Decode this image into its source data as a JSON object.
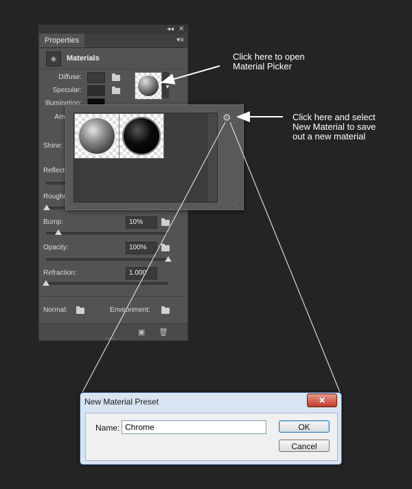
{
  "panel": {
    "tab_label": "Properties",
    "collapse_icon": "◂◂",
    "close_icon": "✕",
    "menu_icon": "▾≡",
    "section_title": "Materials",
    "rows": {
      "diffuse": "Diffuse:",
      "specular": "Specular:",
      "illumination": "Illumination:",
      "ambient": "Ambient:",
      "shine": "Shine:",
      "reflection": "Reflection:",
      "roughness": "Roughness:"
    },
    "bump": {
      "label": "Bump:",
      "value": "10%",
      "level": 0.1
    },
    "opacity": {
      "label": "Opacity:",
      "value": "100%",
      "level": 1.0
    },
    "refraction": {
      "label": "Refraction:",
      "value": "1.000",
      "level": 0.0
    },
    "normal_label": "Normal:",
    "environment_label": "Environment:"
  },
  "picker": {
    "materials": [
      "chrome-sphere",
      "black-glossy-sphere"
    ],
    "gear_icon": "⚙"
  },
  "annotations": {
    "picker_note_line1": "Click here to open",
    "picker_note_line2": "Material Picker",
    "gear_note_line1": "Click here and select",
    "gear_note_line2": "New Material to save",
    "gear_note_line3": "out a new material"
  },
  "dialog": {
    "title": "New Material Preset",
    "close_icon": "✕",
    "name_label": "Name:",
    "name_value": "Chrome",
    "ok_label": "OK",
    "cancel_label": "Cancel"
  },
  "colors": {
    "background": "#242424",
    "panel": "#535353",
    "dialog_frame": "#d8e4f2",
    "close_red": "#c03a2b"
  }
}
